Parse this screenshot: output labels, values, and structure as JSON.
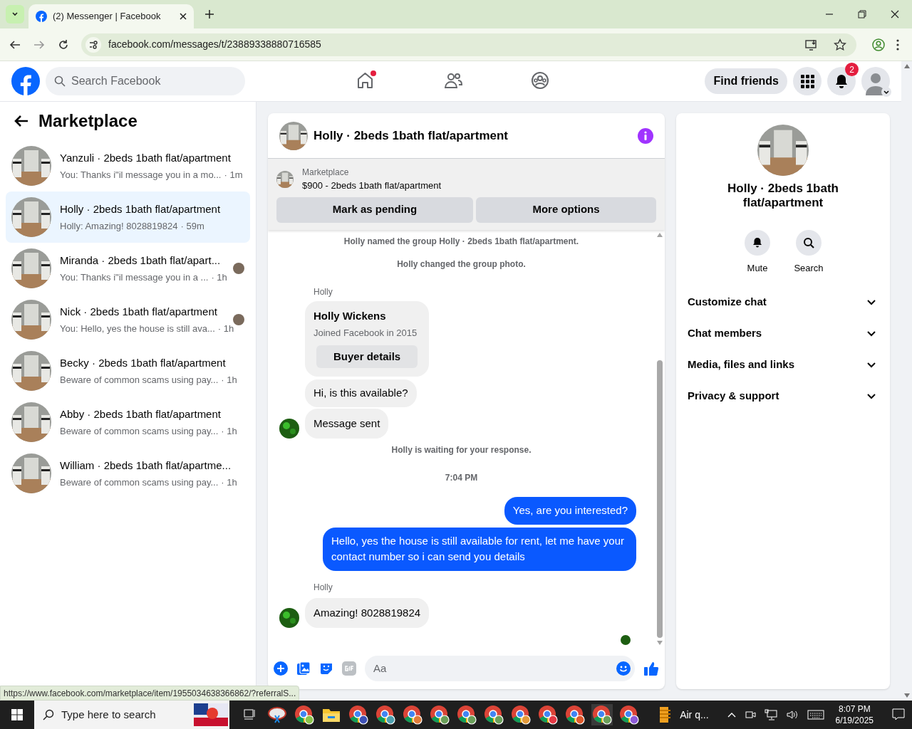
{
  "browser": {
    "tab_title": "(2) Messenger | Facebook",
    "url": "facebook.com/messages/t/23889338880716585"
  },
  "header": {
    "search_placeholder": "Search Facebook",
    "find_friends": "Find friends",
    "notification_count": "2"
  },
  "sidebar": {
    "title": "Marketplace",
    "conversations": [
      {
        "name": "Yanzuli · 2beds 1bath flat/apartment",
        "preview": "You: Thanks i\"il message you in a mo...",
        "time": "· 1m",
        "selected": false,
        "read_receipt": false
      },
      {
        "name": "Holly · 2beds 1bath flat/apartment",
        "preview": "Holly: Amazing! 8028819824",
        "time": "· 59m",
        "selected": true,
        "read_receipt": false
      },
      {
        "name": "Miranda · 2beds 1bath flat/apart...",
        "preview": "You: Thanks i\"il message you in a ...",
        "time": "· 1h",
        "selected": false,
        "read_receipt": true
      },
      {
        "name": "Nick · 2beds 1bath flat/apartment",
        "preview": "You: Hello, yes the house is still ava...",
        "time": "· 1h",
        "selected": false,
        "read_receipt": true
      },
      {
        "name": "Becky · 2beds 1bath flat/apartment",
        "preview": "Beware of common scams using pay...",
        "time": "· 1h",
        "selected": false,
        "read_receipt": false
      },
      {
        "name": "Abby · 2beds 1bath flat/apartment",
        "preview": "Beware of common scams using pay...",
        "time": "· 1h",
        "selected": false,
        "read_receipt": false
      },
      {
        "name": "William · 2beds 1bath flat/apartme...",
        "preview": "Beware of common scams using pay...",
        "time": "· 1h",
        "selected": false,
        "read_receipt": false
      }
    ]
  },
  "chat": {
    "title": "Holly · 2beds 1bath flat/apartment",
    "listing": {
      "label": "Marketplace",
      "text": "$900 - 2beds 1bath flat/apartment",
      "buttons": [
        "Mark as pending",
        "More options"
      ]
    },
    "messages": [
      {
        "kind": "system",
        "text": "Holly named the group Holly · 2beds 1bath flat/apartment."
      },
      {
        "kind": "system",
        "text": "Holly changed the group photo."
      },
      {
        "kind": "sender",
        "text": "Holly"
      },
      {
        "kind": "profile_card",
        "name": "Holly Wickens",
        "subtitle": "Joined Facebook in 2015",
        "button": "Buyer details"
      },
      {
        "kind": "incoming",
        "text": "Hi, is this available?",
        "avatar": false
      },
      {
        "kind": "incoming",
        "text": "Message sent",
        "avatar": true
      },
      {
        "kind": "system",
        "text": "Holly is waiting for your response."
      },
      {
        "kind": "timestamp",
        "text": "7:04 PM"
      },
      {
        "kind": "outgoing",
        "text": "Yes, are you interested?"
      },
      {
        "kind": "outgoing",
        "text": "Hello, yes the house is still available for rent, let me have your contact number so i can send you details"
      },
      {
        "kind": "sender",
        "text": "Holly"
      },
      {
        "kind": "incoming",
        "text": "Amazing! 8028819824",
        "avatar": true
      }
    ],
    "composer_placeholder": "Aa"
  },
  "details": {
    "name": "Holly · 2beds 1bath flat/apartment",
    "actions": [
      "Mute",
      "Search"
    ],
    "sections": [
      "Customize chat",
      "Chat members",
      "Media, files and links",
      "Privacy & support"
    ]
  },
  "status_link": "https://www.facebook.com/marketplace/item/1955034638366862/?referralS...",
  "taskbar": {
    "search_placeholder": "Type here to search",
    "weather": "Air q...",
    "time": "8:07 PM",
    "date": "6/19/2025"
  }
}
